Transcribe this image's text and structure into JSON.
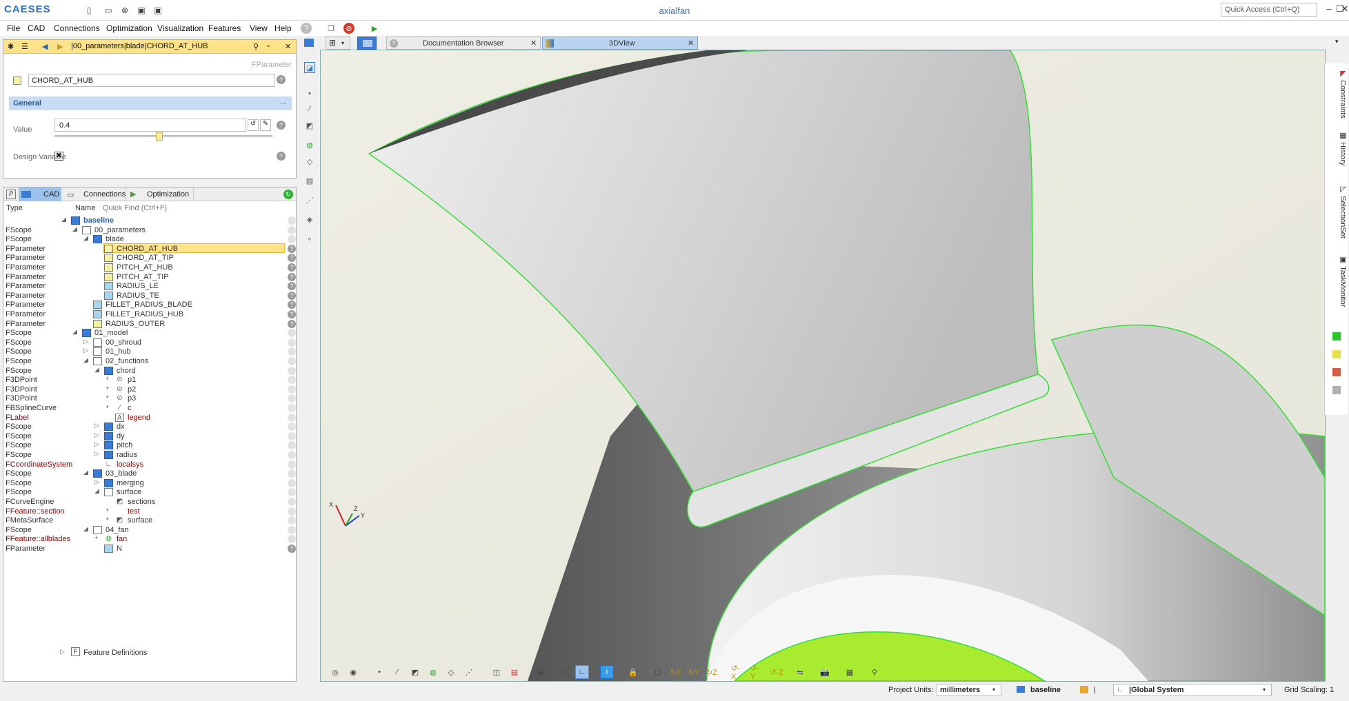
{
  "app": {
    "logo": "CAESES",
    "title": "axialfan",
    "quick_access": "Quick Access (Ctrl+Q)"
  },
  "menus": [
    "File",
    "CAD",
    "Connections",
    "Optimization",
    "Visualization",
    "Features",
    "View",
    "Help"
  ],
  "param_panel": {
    "path": "|00_parameters|blade|CHORD_AT_HUB",
    "type_label": "FParameter",
    "name": "CHORD_AT_HUB",
    "section": "General",
    "section_more": "...",
    "value_label": "Value",
    "value": "0.4",
    "slider_fraction": 0.48,
    "design_variable_label": "Design Variable"
  },
  "tree_panel": {
    "tabs": [
      "P",
      "CAD",
      "Connections",
      "Optimization"
    ],
    "col_type": "Type",
    "col_name": "Name",
    "quick_find": "Quick Find (Ctrl+F)",
    "footer": "Feature Definitions",
    "rows": [
      {
        "type": "",
        "name": "baseline",
        "level": 0,
        "icon": "folder",
        "bold": true,
        "blue": true,
        "toggle": "◢"
      },
      {
        "type": "FScope",
        "name": "00_parameters",
        "level": 1,
        "icon": "folderw",
        "toggle": "◢"
      },
      {
        "type": "FScope",
        "name": "blade",
        "level": 2,
        "icon": "folder",
        "toggle": "◢"
      },
      {
        "type": "FParameter",
        "name": "CHORD_AT_HUB",
        "level": 3,
        "icon": "param",
        "selected": true,
        "q": true
      },
      {
        "type": "FParameter",
        "name": "CHORD_AT_TIP",
        "level": 3,
        "icon": "param",
        "q": true
      },
      {
        "type": "FParameter",
        "name": "PITCH_AT_HUB",
        "level": 3,
        "icon": "param",
        "q": true
      },
      {
        "type": "FParameter",
        "name": "PITCH_AT_TIP",
        "level": 3,
        "icon": "param",
        "q": true
      },
      {
        "type": "FParameter",
        "name": "RADIUS_LE",
        "level": 3,
        "icon": "paramb",
        "q": true
      },
      {
        "type": "FParameter",
        "name": "RADIUS_TE",
        "level": 3,
        "icon": "paramb",
        "q": true
      },
      {
        "type": "FParameter",
        "name": "FILLET_RADIUS_BLADE",
        "level": 2,
        "icon": "paramb",
        "q": true
      },
      {
        "type": "FParameter",
        "name": "FILLET_RADIUS_HUB",
        "level": 2,
        "icon": "paramb",
        "q": true
      },
      {
        "type": "FParameter",
        "name": "RADIUS_OUTER",
        "level": 2,
        "icon": "param",
        "q": true
      },
      {
        "type": "FScope",
        "name": "01_model",
        "level": 1,
        "icon": "folder",
        "toggle": "◢"
      },
      {
        "type": "FScope",
        "name": "00_shroud",
        "level": 2,
        "icon": "folderw",
        "toggle": "▷"
      },
      {
        "type": "FScope",
        "name": "01_hub",
        "level": 2,
        "icon": "folderw",
        "toggle": "▷"
      },
      {
        "type": "FScope",
        "name": "02_functions",
        "level": 2,
        "icon": "folderw",
        "toggle": "◢"
      },
      {
        "type": "FScope",
        "name": "chord",
        "level": 3,
        "icon": "folder",
        "toggle": "◢"
      },
      {
        "type": "F3DPoint",
        "name": "p1",
        "level": 4,
        "icon": "dot",
        "toggle": "+"
      },
      {
        "type": "F3DPoint",
        "name": "p2",
        "level": 4,
        "icon": "dot",
        "toggle": "+"
      },
      {
        "type": "F3DPoint",
        "name": "p3",
        "level": 4,
        "icon": "dot",
        "toggle": "+"
      },
      {
        "type": "FBSplineCurve",
        "name": "c",
        "level": 4,
        "icon": "curve",
        "toggle": "+"
      },
      {
        "type": "FLabel",
        "name": "legend",
        "level": 4,
        "icon": "label",
        "red": true
      },
      {
        "type": "FScope",
        "name": "dx",
        "level": 3,
        "icon": "folder",
        "toggle": "▷"
      },
      {
        "type": "FScope",
        "name": "dy",
        "level": 3,
        "icon": "folder",
        "toggle": "▷"
      },
      {
        "type": "FScope",
        "name": "pitch",
        "level": 3,
        "icon": "folder",
        "toggle": "▷"
      },
      {
        "type": "FScope",
        "name": "radius",
        "level": 3,
        "icon": "folder",
        "toggle": "▷"
      },
      {
        "type": "FCoordinateSystem",
        "name": "localsys",
        "level": 3,
        "icon": "coord",
        "red": true
      },
      {
        "type": "FScope",
        "name": "03_blade",
        "level": 2,
        "icon": "folder",
        "toggle": "◢"
      },
      {
        "type": "FScope",
        "name": "merging",
        "level": 3,
        "icon": "folder",
        "toggle": "▷"
      },
      {
        "type": "FScope",
        "name": "surface",
        "level": 3,
        "icon": "folderw",
        "toggle": "◢"
      },
      {
        "type": "FCurveEngine",
        "name": "sections",
        "level": 4,
        "icon": "engine"
      },
      {
        "type": "FFeature::section",
        "name": "test",
        "level": 4,
        "icon": "none",
        "toggle": "+",
        "red": true
      },
      {
        "type": "FMetaSurface",
        "name": "surface",
        "level": 4,
        "icon": "engine",
        "toggle": "+"
      },
      {
        "type": "FScope",
        "name": "04_fan",
        "level": 2,
        "icon": "folderw",
        "toggle": "◢"
      },
      {
        "type": "FFeature::allblades",
        "name": "fan",
        "level": 3,
        "icon": "fan",
        "toggle": "+",
        "red": true
      },
      {
        "type": "FParameter",
        "name": "N",
        "level": 3,
        "icon": "paramb",
        "q": true
      }
    ]
  },
  "view_tabs": [
    {
      "label": "Documentation Browser",
      "active": false
    },
    {
      "label": "3DView",
      "active": true
    }
  ],
  "side_tabs": [
    "Constraints",
    "History",
    "SelectionSet",
    "TaskMonitor"
  ],
  "side_colors": [
    "#2ec42e",
    "#e8e24a",
    "#d95b43",
    "#b0b0b0"
  ],
  "status": {
    "units_label": "Project Units:",
    "units": "millimeters",
    "design": "baseline",
    "system": "|Global System",
    "grid": "Grid Scaling: 1"
  },
  "axes": {
    "x": "X",
    "y": "Y",
    "z": "Z"
  }
}
